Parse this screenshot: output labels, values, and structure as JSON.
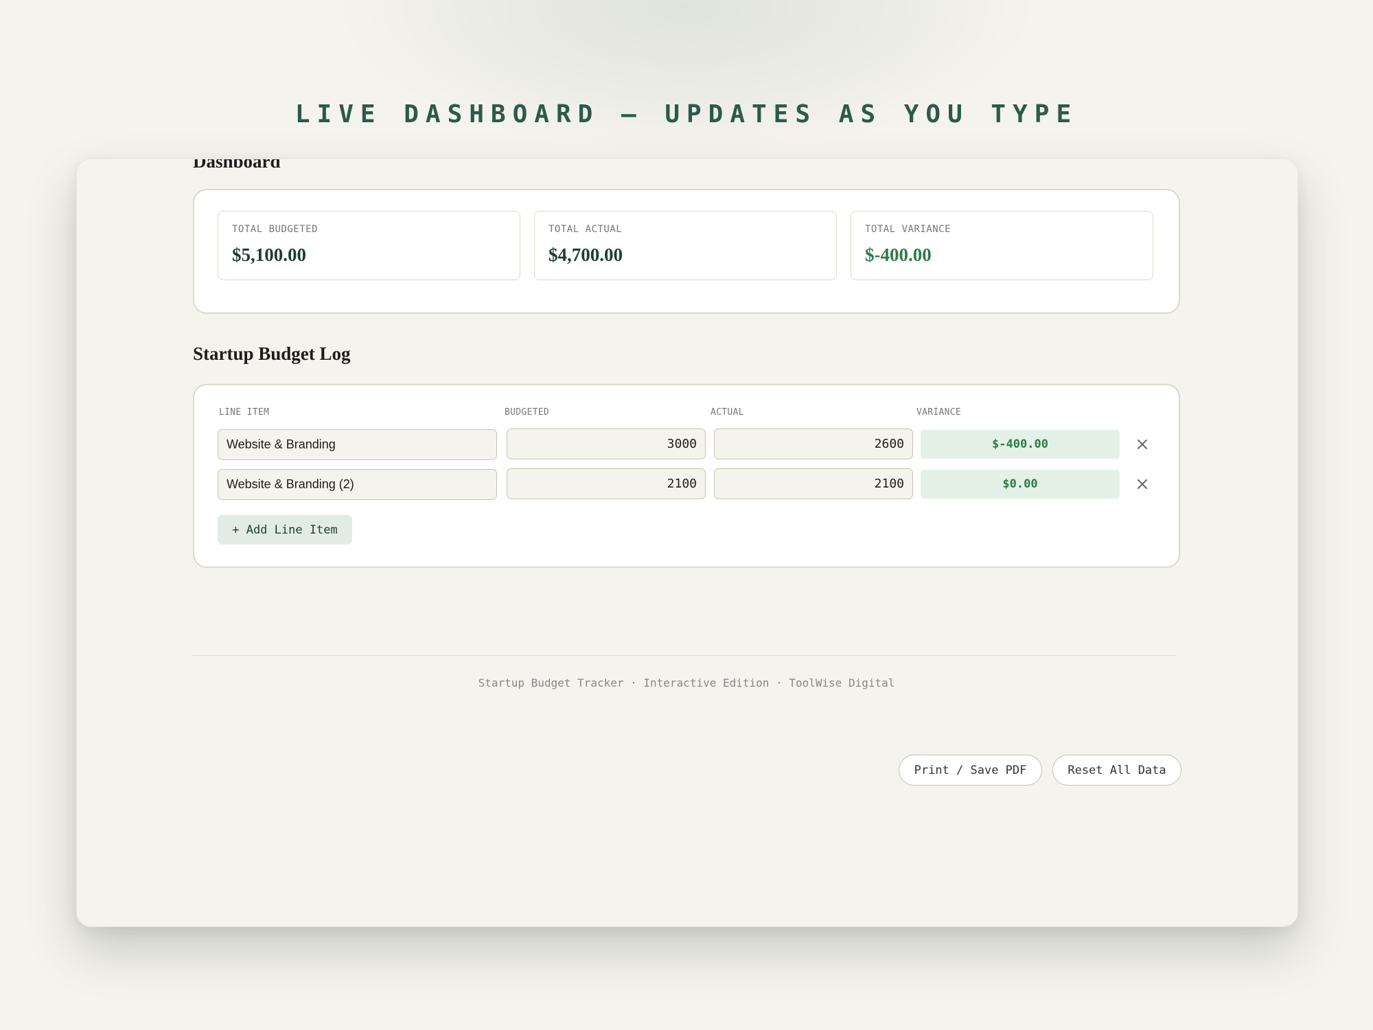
{
  "banner": "LIVE DASHBOARD — UPDATES AS YOU TYPE",
  "dashboard": {
    "title": "Dashboard",
    "stats": [
      {
        "label": "TOTAL BUDGETED",
        "value": "$5,100.00"
      },
      {
        "label": "TOTAL ACTUAL",
        "value": "$4,700.00"
      },
      {
        "label": "TOTAL VARIANCE",
        "value": "$-400.00"
      }
    ]
  },
  "log": {
    "title": "Startup Budget Log",
    "columns": {
      "item": "LINE ITEM",
      "budgeted": "BUDGETED",
      "actual": "ACTUAL",
      "variance": "VARIANCE"
    },
    "rows": [
      {
        "item": "Website & Branding",
        "budgeted": "3000",
        "actual": "2600",
        "variance": "$-400.00"
      },
      {
        "item": "Website & Branding (2)",
        "budgeted": "2100",
        "actual": "2100",
        "variance": "$0.00"
      }
    ],
    "add_label": "+ Add Line Item",
    "remove_glyph": "×"
  },
  "actions": {
    "print_label": "Print / Save PDF",
    "reset_label": "Reset All Data"
  },
  "footer": "Startup Budget Tracker · Interactive Edition · ToolWise Digital",
  "colors": {
    "accent": "#2c5a4a",
    "positive": "#2f7a4b",
    "badge_bg": "#e4f1e7",
    "border": "#ddd9c7"
  }
}
